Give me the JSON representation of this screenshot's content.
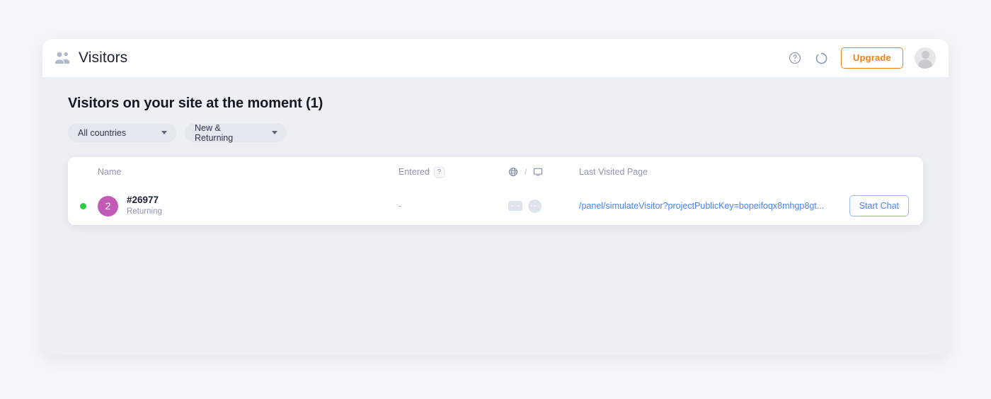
{
  "header": {
    "title": "Visitors",
    "people_icon": "people-icon",
    "help_icon": "help-circle-icon",
    "refresh_icon": "refresh-spinner-icon",
    "upgrade_label": "Upgrade",
    "avatar_icon": "user-avatar-icon",
    "accent_color": "#f08020"
  },
  "main": {
    "section_title": "Visitors on your site at the moment (1)",
    "filters": [
      {
        "label": "All countries",
        "icon": "chevron-down-icon"
      },
      {
        "label": "New & Returning",
        "icon": "chevron-down-icon"
      }
    ],
    "table": {
      "columns": {
        "name": "Name",
        "entered": "Entered",
        "entered_help": "?",
        "device_globe_icon": "globe-icon",
        "device_separator": "/",
        "device_monitor_icon": "monitor-icon",
        "last_visited_page": "Last Visited Page"
      },
      "rows": [
        {
          "online": true,
          "status_color": "#2ecc40",
          "avatar_count": "2",
          "avatar_color": "#c25bb5",
          "name": "#26977",
          "visitor_type": "Returning",
          "entered": "-",
          "country_placeholder": "loading-placeholder",
          "browser_placeholder": "loading-placeholder",
          "last_visited_page": "/panel/simulateVisitor?projectPublicKey=bopeifoqx8mhgp8gt...",
          "action_label": "Start Chat",
          "link_color": "#4d82f3"
        }
      ]
    }
  }
}
